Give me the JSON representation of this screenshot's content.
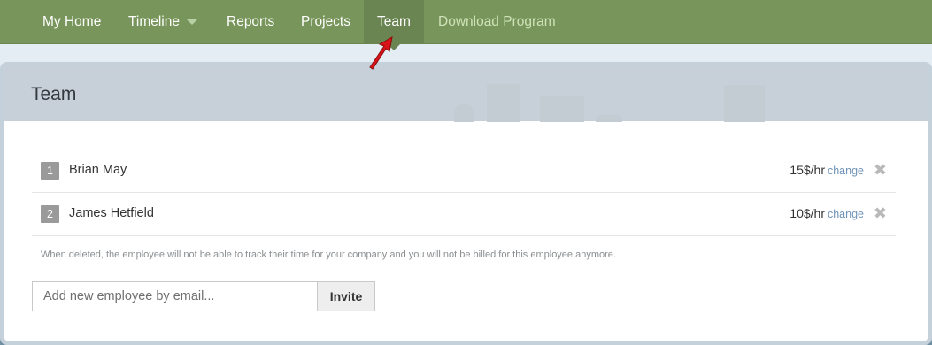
{
  "nav": {
    "items": [
      {
        "label": "My Home"
      },
      {
        "label": "Timeline"
      },
      {
        "label": "Reports"
      },
      {
        "label": "Projects"
      },
      {
        "label": "Team"
      },
      {
        "label": "Download Program"
      }
    ],
    "active": "Team",
    "colors": {
      "bar": "#78965b",
      "active": "#6a8552",
      "download_text": "#cfe2b8"
    }
  },
  "panel": {
    "title": "Team"
  },
  "employees": [
    {
      "number": "1",
      "name": "Brian May",
      "rate": "15$/hr",
      "change_label": "change"
    },
    {
      "number": "2",
      "name": "James Hetfield",
      "rate": "10$/hr",
      "change_label": "change"
    }
  ],
  "icons": {
    "remove": "close-x-icon",
    "caret": "chevron-down-icon",
    "pointer": "red-arrow-icon"
  },
  "note": "When deleted, the employee will not be able to track their time for your company and you will not be billed for this employee anymore.",
  "invite": {
    "placeholder": "Add new employee by email...",
    "value": "",
    "button_label": "Invite"
  },
  "colors": {
    "link": "#6f93b8",
    "header": "#c7d0d8",
    "accent_arrow": "#d8141a"
  }
}
